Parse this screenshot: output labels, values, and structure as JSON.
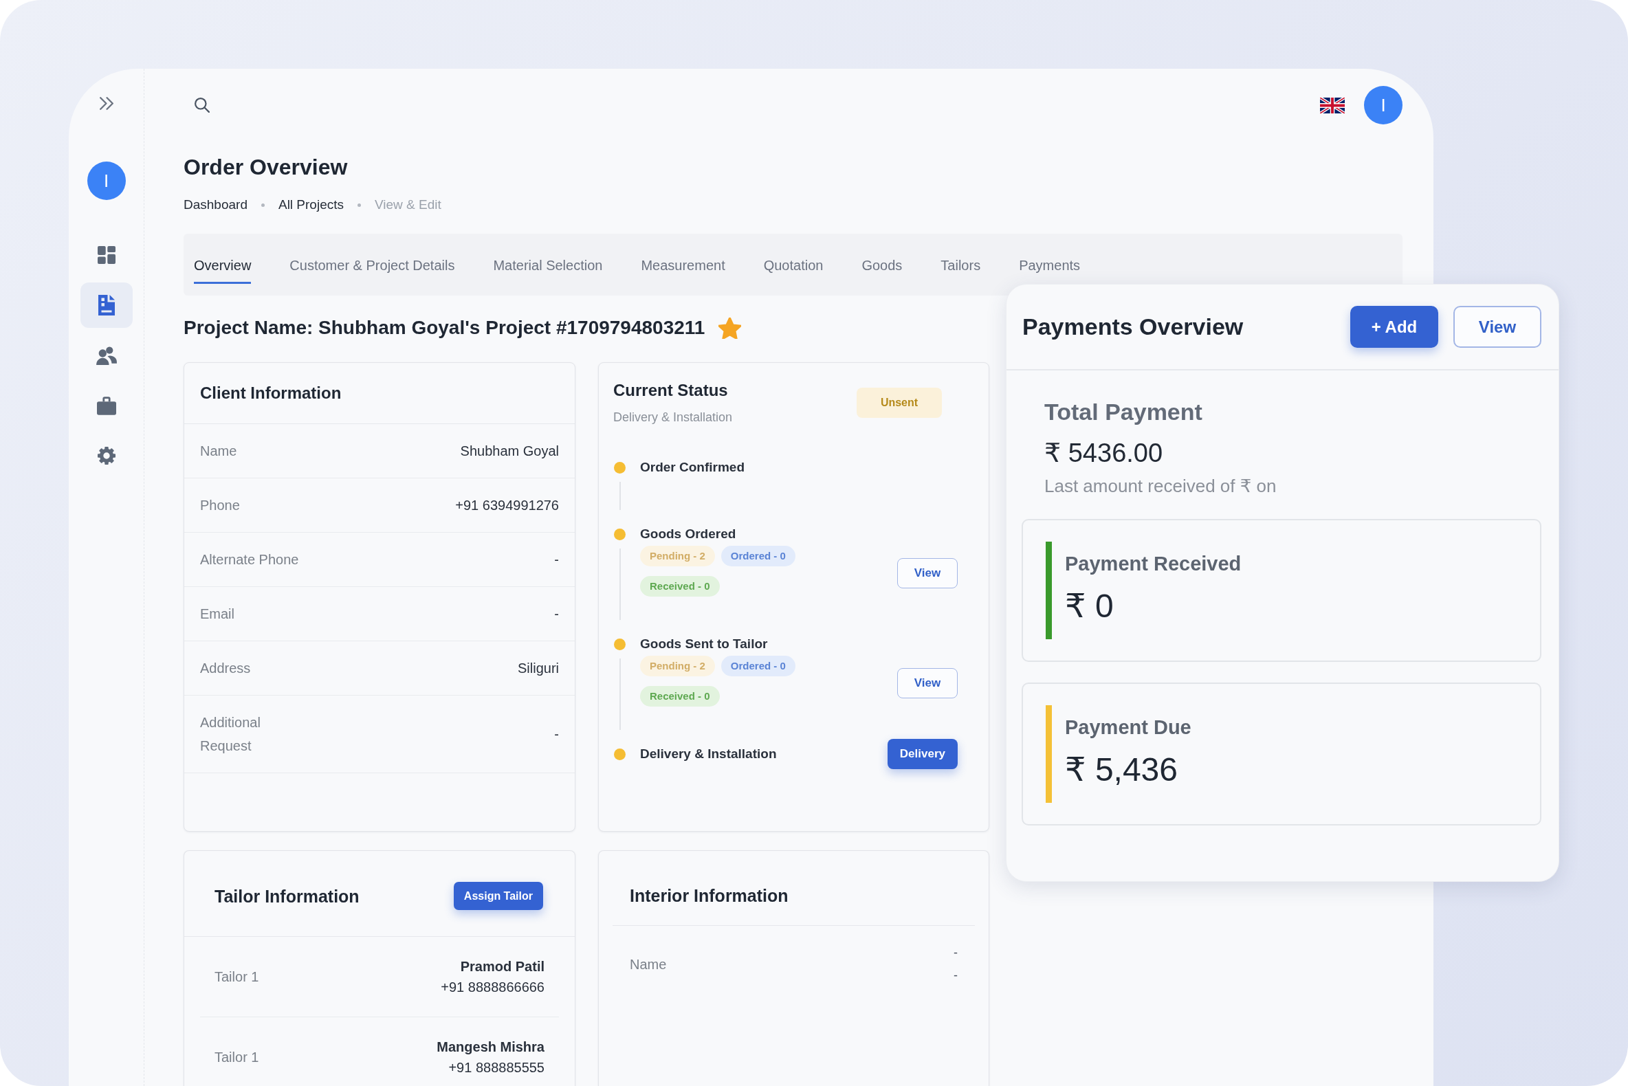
{
  "sidebar": {
    "avatar": "I",
    "items": [
      {
        "selected": false
      },
      {
        "selected": true
      },
      {
        "selected": false
      },
      {
        "selected": false
      },
      {
        "selected": false
      }
    ]
  },
  "header": {
    "avatar": "I"
  },
  "page": {
    "title": "Order Overview",
    "breadcrumb": [
      {
        "label": "Dashboard",
        "current": false
      },
      {
        "label": "All Projects",
        "current": false
      },
      {
        "label": "View & Edit",
        "current": true
      }
    ]
  },
  "tabs": [
    {
      "label": "Overview",
      "selected": true
    },
    {
      "label": "Customer & Project Details",
      "selected": false
    },
    {
      "label": "Material Selection",
      "selected": false
    },
    {
      "label": "Measurement",
      "selected": false
    },
    {
      "label": "Quotation",
      "selected": false
    },
    {
      "label": "Goods",
      "selected": false
    },
    {
      "label": "Tailors",
      "selected": false
    },
    {
      "label": "Payments",
      "selected": false
    }
  ],
  "project": {
    "title": "Project Name: Shubham Goyal's Project #1709794803211",
    "starred": true
  },
  "client_information": {
    "title": "Client Information",
    "rows": [
      {
        "label": "Name",
        "value": "Shubham Goyal"
      },
      {
        "label": "Phone",
        "value": "+91 6394991276"
      },
      {
        "label": "Alternate Phone",
        "value": "-"
      },
      {
        "label": "Email",
        "value": "-"
      },
      {
        "label": "Address",
        "value": "Siliguri"
      },
      {
        "label": "Additional Request",
        "value": "-"
      }
    ]
  },
  "current_status": {
    "title": "Current Status",
    "subtitle": "Delivery & Installation",
    "badge": "Unsent",
    "steps": [
      {
        "label": "Order Confirmed"
      },
      {
        "label": "Goods Ordered",
        "tags": [
          {
            "label": "Pending - 2",
            "kind": "pending"
          },
          {
            "label": "Ordered - 0",
            "kind": "ordered"
          },
          {
            "label": "Received - 0",
            "kind": "received"
          }
        ],
        "action": {
          "label": "View",
          "kind": "outline"
        }
      },
      {
        "label": "Goods Sent to Tailor",
        "tags": [
          {
            "label": "Pending - 2",
            "kind": "pending"
          },
          {
            "label": "Ordered - 0",
            "kind": "ordered"
          },
          {
            "label": "Received - 0",
            "kind": "received"
          }
        ],
        "action": {
          "label": "View",
          "kind": "outline"
        }
      },
      {
        "label": "Delivery & Installation",
        "action": {
          "label": "Delivery",
          "kind": "primary"
        }
      }
    ]
  },
  "tailor_information": {
    "title": "Tailor Information",
    "button": "Assign Tailor",
    "rows": [
      {
        "label": "Tailor 1",
        "name": "Pramod Patil",
        "phone": "+91 8888866666"
      },
      {
        "label": "Tailor 1",
        "name": "Mangesh Mishra",
        "phone": "+91 888885555"
      }
    ]
  },
  "interior_information": {
    "title": "Interior Information",
    "rows": [
      {
        "label": "Name",
        "values": [
          "-",
          "-"
        ]
      }
    ]
  },
  "payments_overview": {
    "title": "Payments Overview",
    "buttons": [
      {
        "label": "+ Add",
        "kind": "primary"
      },
      {
        "label": "View",
        "kind": "outline"
      }
    ],
    "total": {
      "label": "Total Payment",
      "amount": "₹ 5436.00",
      "note": "Last amount received of ₹ on"
    },
    "cards": [
      {
        "label": "Payment Received",
        "amount": "₹ 0",
        "color": "#3a9a2c"
      },
      {
        "label": "Payment Due",
        "amount": "₹ 5,436",
        "color": "#f4c137"
      }
    ]
  }
}
